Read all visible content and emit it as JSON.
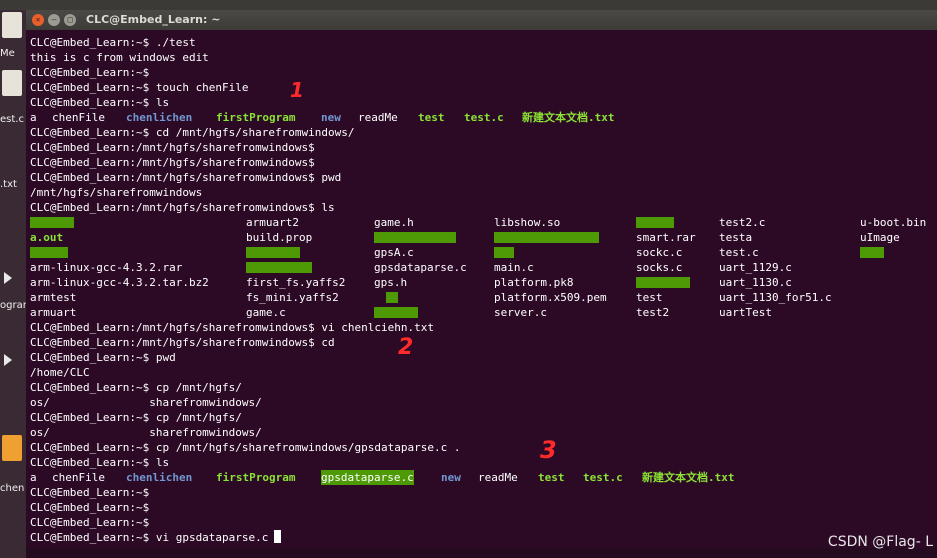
{
  "window": {
    "title": "CLC@Embed_Learn: ~"
  },
  "launcher": {
    "labels": [
      "Me",
      "est.c",
      ".txt",
      "ogram",
      "chen"
    ]
  },
  "terminal": {
    "lines": [
      "CLC@Embed_Learn:~$ ./test",
      "this is c from windows edit",
      "CLC@Embed_Learn:~$",
      "CLC@Embed_Learn:~$ touch chenFile",
      "CLC@Embed_Learn:~$ ls",
      "",
      "CLC@Embed_Learn:~$ cd /mnt/hgfs/sharefromwindows/",
      "CLC@Embed_Learn:/mnt/hgfs/sharefromwindows$",
      "CLC@Embed_Learn:/mnt/hgfs/sharefromwindows$",
      "CLC@Embed_Learn:/mnt/hgfs/sharefromwindows$ pwd",
      "/mnt/hgfs/sharefromwindows",
      "CLC@Embed_Learn:/mnt/hgfs/sharefromwindows$ ls",
      "",
      "",
      "",
      "",
      "",
      "",
      "",
      "CLC@Embed_Learn:/mnt/hgfs/sharefromwindows$ vi chenlciehn.txt",
      "CLC@Embed_Learn:/mnt/hgfs/sharefromwindows$ cd",
      "CLC@Embed_Learn:~$ pwd",
      "/home/CLC",
      "CLC@Embed_Learn:~$ cp /mnt/hgfs/",
      "os/               sharefromwindows/",
      "CLC@Embed_Learn:~$ cp /mnt/hgfs/",
      "os/               sharefromwindows/",
      "CLC@Embed_Learn:~$ cp /mnt/hgfs/sharefromwindows/gpsdataparse.c .",
      "CLC@Embed_Learn:~$ ls",
      "",
      "CLC@Embed_Learn:~$",
      "CLC@Embed_Learn:~$",
      "CLC@Embed_Learn:~$",
      "CLC@Embed_Learn:~$ vi gpsdataparse.c"
    ],
    "ls_home_1": [
      "a",
      "chenFile",
      "chenlichen",
      "firstProgram",
      "new",
      "readMe",
      "test",
      "test.c",
      "新建文本文档.txt"
    ],
    "ls_share": [
      [
        "armuart2",
        "game.h",
        "libshow.so",
        "test2.c",
        "u-boot.bin"
      ],
      [
        "a.out",
        "build.prop",
        "smart.rar",
        "testa",
        "uImage"
      ],
      [
        "gpsA.c",
        "sockc.c",
        "test.c"
      ],
      [
        "arm-linux-gcc-4.3.2.rar",
        "gpsdataparse.c",
        "main.c",
        "socks.c",
        "uart_1129.c"
      ],
      [
        "arm-linux-gcc-4.3.2.tar.bz2",
        "first_fs.yaffs2",
        "gps.h",
        "platform.pk8",
        "uart_1130.c"
      ],
      [
        "armtest",
        "fs_mini.yaffs2",
        "platform.x509.pem",
        "test",
        "uart_1130_for51.c"
      ],
      [
        "armuart",
        "game.c",
        "server.c",
        "test2",
        "uartTest"
      ]
    ],
    "ls_home_2": [
      "a",
      "chenFile",
      "chenlichen",
      "firstProgram",
      "gpsdataparse.c",
      "new",
      "readMe",
      "test",
      "test.c",
      "新建文本文档.txt"
    ]
  },
  "annotations": [
    "1",
    "2",
    "3"
  ],
  "watermark": "CSDN @Flag- L",
  "colors": {
    "background": "#2c0a26",
    "directory": "#7296cf",
    "executable": "#8ae234",
    "highlight": "#4e9a06",
    "annotation": "#ff2b2b"
  }
}
